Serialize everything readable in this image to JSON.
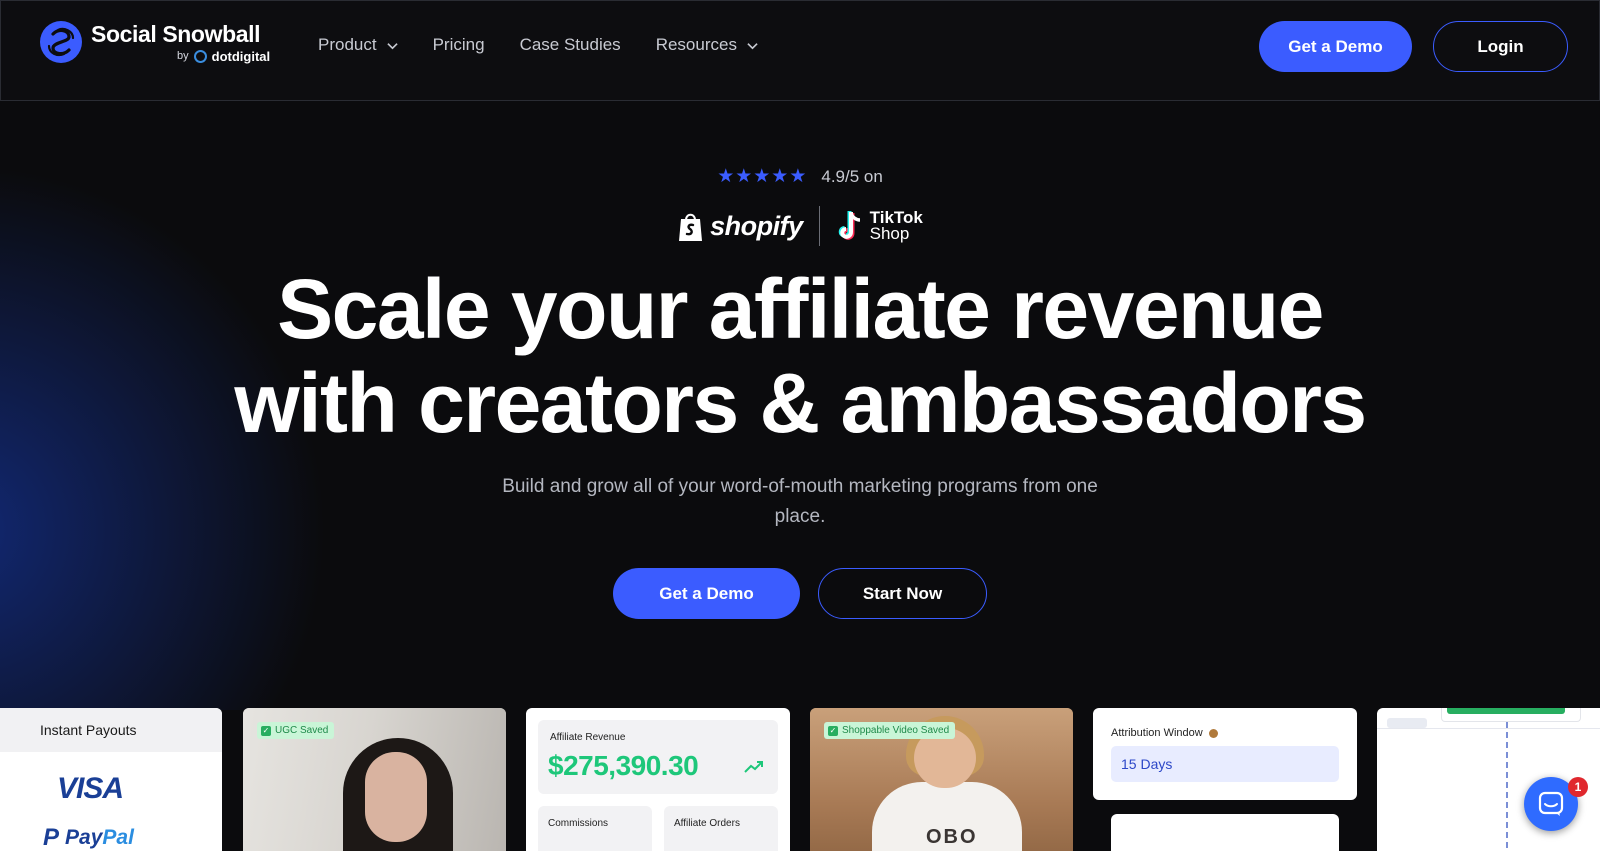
{
  "nav": {
    "logo_title": "Social Snowball",
    "logo_by": "by",
    "logo_brand": "dotdigital",
    "links": [
      {
        "label": "Product",
        "has_dropdown": true
      },
      {
        "label": "Pricing",
        "has_dropdown": false
      },
      {
        "label": "Case Studies",
        "has_dropdown": false
      },
      {
        "label": "Resources",
        "has_dropdown": true
      }
    ],
    "demo_label": "Get a Demo",
    "login_label": "Login"
  },
  "hero": {
    "stars": "★★★★★",
    "rating_text": "4.9/5 on",
    "shopify_label": "shopify",
    "tiktok_line1": "TikTok",
    "tiktok_line2": "Shop",
    "headline_line1": "Scale your affiliate revenue",
    "headline_line2": "with creators & ambassadors",
    "subline": "Build and grow all of your word-of-mouth marketing programs from one place.",
    "demo_label": "Get a Demo",
    "start_label": "Start Now"
  },
  "cards": {
    "payouts_title": "Instant Payouts",
    "visa_label": "VISA",
    "paypal_mark": "P",
    "paypal_label_a": "Pay",
    "paypal_label_b": "Pal",
    "ugc_chip": "UGC Saved",
    "revenue_label": "Affiliate Revenue",
    "revenue_value": "$275,390.30",
    "commissions_label": "Commissions",
    "orders_label": "Affiliate Orders",
    "shoppable_chip": "Shoppable Video Saved",
    "shirt_text": "OBO",
    "attribution_label": "Attribution Window",
    "attribution_value": "15 Days"
  },
  "chat": {
    "badge_count": "1"
  },
  "colors": {
    "accent": "#3b5cff",
    "background": "#0b0b0d",
    "positive": "#1ec77a",
    "badge": "#e0282e"
  },
  "icons": [
    "logo-mark-icon",
    "chevron-down-icon",
    "star-icon",
    "shopify-bag-icon",
    "tiktok-icon",
    "check-icon",
    "trend-up-icon",
    "cookie-icon",
    "chat-icon"
  ]
}
